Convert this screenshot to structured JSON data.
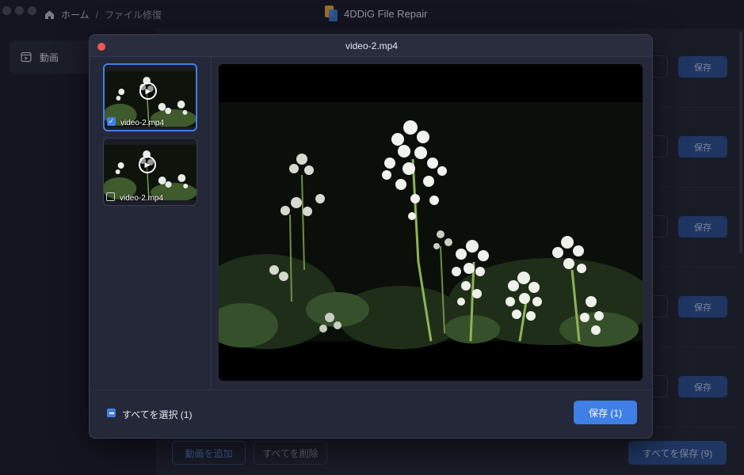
{
  "breadcrumb": {
    "home": "ホーム",
    "separator": "/",
    "current": "ファイル修復"
  },
  "app": {
    "title": "4DDiG File Repair"
  },
  "sidebar": {
    "items": [
      {
        "label": "動画",
        "icon": "video-icon"
      }
    ]
  },
  "main": {
    "rows": [
      {
        "save_label": "保存"
      },
      {
        "save_label": "保存"
      },
      {
        "save_label": "保存"
      },
      {
        "save_label": "保存"
      },
      {
        "save_label": "保存"
      }
    ],
    "add_video": "動画を追加",
    "delete_all": "すべてを削除",
    "save_all": "すべてを保存 (9)"
  },
  "modal": {
    "title": "video-2.mp4",
    "thumbnails": [
      {
        "name": "video-2.mp4",
        "checked": true
      },
      {
        "name": "video-2.mp4",
        "checked": false
      }
    ],
    "select_all": "すべてを選択 (1)",
    "save": "保存 (1)"
  },
  "colors": {
    "accent": "#3f7fe6",
    "muted_accent": "#2c4f8e",
    "close": "#ee5a52",
    "background": "#1b1d2a",
    "panel": "#222534",
    "modal": "#252838"
  }
}
